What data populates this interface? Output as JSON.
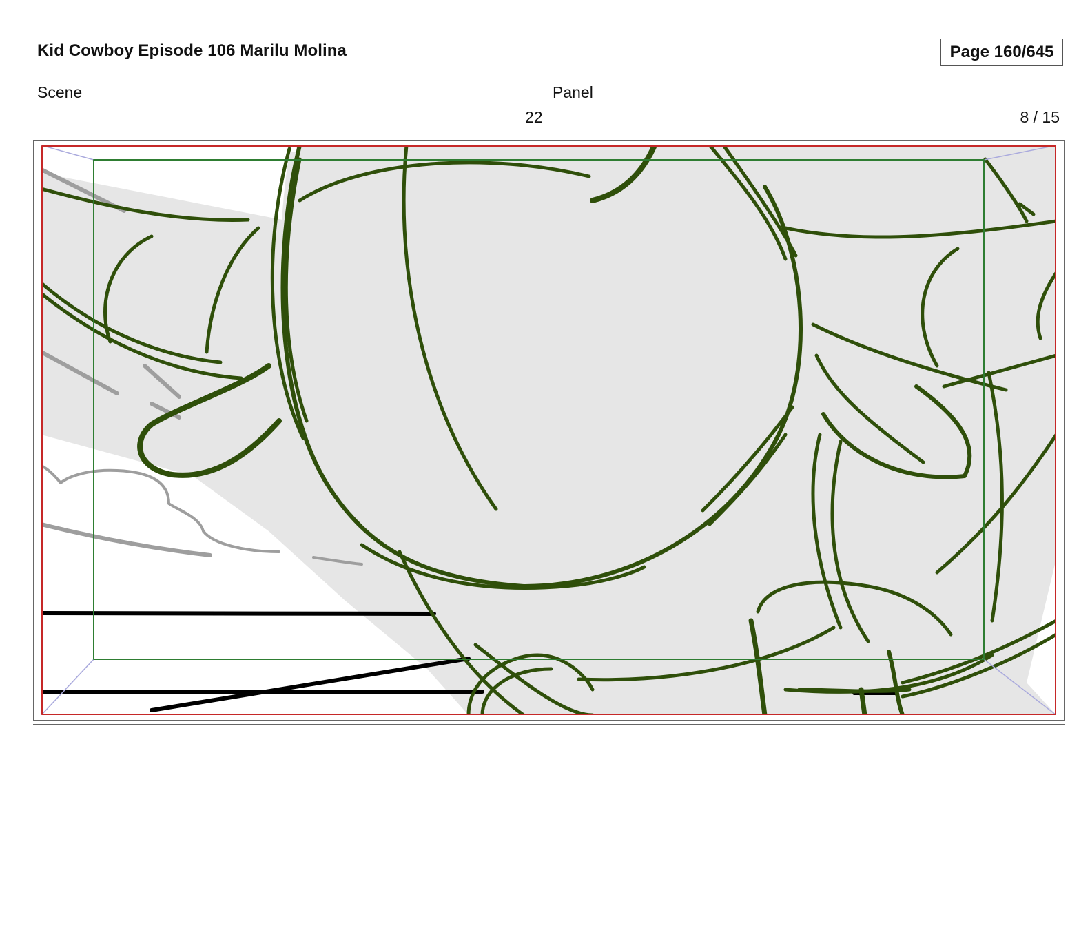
{
  "header": {
    "title": "Kid Cowboy Episode 106 Marilu Molina",
    "page_indicator": "Page 160/645"
  },
  "labels": {
    "scene": "Scene",
    "panel": "Panel"
  },
  "values": {
    "scene_number": "22",
    "panel_number": "8 / 15"
  },
  "colors": {
    "sketch_line": "#2f4f0a",
    "fill_gray": "#e6e6e6",
    "safe_frame": "#2e7d32",
    "camera_frame": "#c62828",
    "perspective_guides": "#aaaadd",
    "background_lines": "#9e9e9e"
  }
}
